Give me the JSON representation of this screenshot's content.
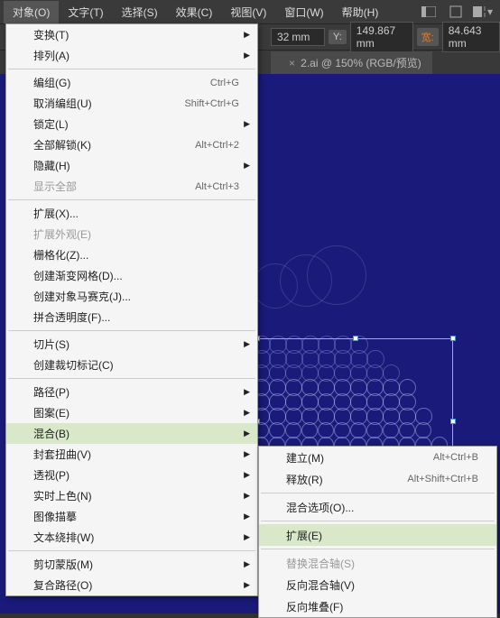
{
  "menubar": {
    "items": [
      "对象(O)",
      "文字(T)",
      "选择(S)",
      "效果(C)",
      "视图(V)",
      "窗口(W)",
      "帮助(H)"
    ]
  },
  "toolbar": {
    "unit": "mm",
    "y_label": "Y:",
    "y_val": "149.867",
    "w_label": "宽:",
    "w_val": "84.643",
    "pre_val": "32"
  },
  "tab": {
    "title": "2.ai @ 150% (RGB/预览)"
  },
  "menu": {
    "items": [
      {
        "t": "变换(T)",
        "sub": true
      },
      {
        "t": "排列(A)",
        "sub": true
      },
      {
        "sep": true
      },
      {
        "t": "编组(G)",
        "sc": "Ctrl+G"
      },
      {
        "t": "取消编组(U)",
        "sc": "Shift+Ctrl+G"
      },
      {
        "t": "锁定(L)",
        "sub": true
      },
      {
        "t": "全部解锁(K)",
        "sc": "Alt+Ctrl+2"
      },
      {
        "t": "隐藏(H)",
        "sub": true
      },
      {
        "t": "显示全部",
        "sc": "Alt+Ctrl+3",
        "dis": true
      },
      {
        "sep": true
      },
      {
        "t": "扩展(X)..."
      },
      {
        "t": "扩展外观(E)",
        "dis": true
      },
      {
        "t": "栅格化(Z)..."
      },
      {
        "t": "创建渐变网格(D)..."
      },
      {
        "t": "创建对象马赛克(J)..."
      },
      {
        "t": "拼合透明度(F)..."
      },
      {
        "sep": true
      },
      {
        "t": "切片(S)",
        "sub": true
      },
      {
        "t": "创建裁切标记(C)"
      },
      {
        "sep": true
      },
      {
        "t": "路径(P)",
        "sub": true
      },
      {
        "t": "图案(E)",
        "sub": true
      },
      {
        "t": "混合(B)",
        "sub": true,
        "hl": true
      },
      {
        "t": "封套扭曲(V)",
        "sub": true
      },
      {
        "t": "透视(P)",
        "sub": true
      },
      {
        "t": "实时上色(N)",
        "sub": true
      },
      {
        "t": "图像描摹",
        "sub": true
      },
      {
        "t": "文本绕排(W)",
        "sub": true
      },
      {
        "sep": true
      },
      {
        "t": "剪切蒙版(M)",
        "sub": true
      },
      {
        "t": "复合路径(O)",
        "sub": true
      }
    ]
  },
  "submenu": {
    "items": [
      {
        "t": "建立(M)",
        "sc": "Alt+Ctrl+B"
      },
      {
        "t": "释放(R)",
        "sc": "Alt+Shift+Ctrl+B"
      },
      {
        "sep": true
      },
      {
        "t": "混合选项(O)..."
      },
      {
        "sep": true
      },
      {
        "t": "扩展(E)",
        "hl": true
      },
      {
        "sep": true
      },
      {
        "t": "替换混合轴(S)",
        "dis": true
      },
      {
        "t": "反向混合轴(V)"
      },
      {
        "t": "反向堆叠(F)"
      }
    ]
  }
}
